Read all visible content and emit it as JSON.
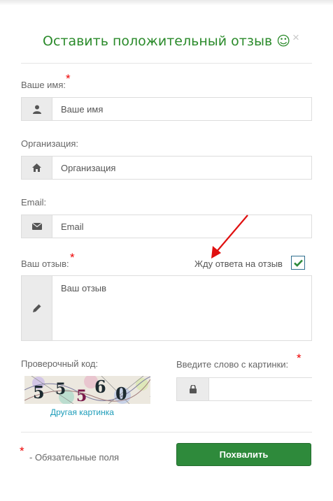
{
  "modal": {
    "title": "Оставить положительный отзыв ☺",
    "close_label": "×"
  },
  "form": {
    "name": {
      "label": "Ваше имя:",
      "required": "*",
      "placeholder": "Ваше имя",
      "icon": "user-icon"
    },
    "org": {
      "label": "Организация:",
      "placeholder": "Организация",
      "icon": "home-icon"
    },
    "email": {
      "label": "Email:",
      "placeholder": "Email",
      "icon": "envelope-icon"
    },
    "review": {
      "label": "Ваш отзыв:",
      "required": "*",
      "placeholder": "Ваш отзыв",
      "icon": "pencil-icon"
    },
    "await_reply": {
      "label": "Жду ответа на отзыв",
      "checked": true
    },
    "captcha": {
      "label": "Проверочный код:",
      "digits": "55560",
      "refresh_label": "Другая картинка",
      "input_label": "Введите слово с картинки:",
      "required": "*",
      "icon": "lock-icon",
      "value": ""
    },
    "footer": {
      "required_star": "*",
      "required_note": "- Обязательные поля",
      "submit_label": "Похвалить"
    }
  },
  "colors": {
    "title": "#2a8a2a",
    "required": "#e00000",
    "button": "#2e8a3b",
    "link": "#1a9bb8",
    "arrow": "#e01010"
  }
}
